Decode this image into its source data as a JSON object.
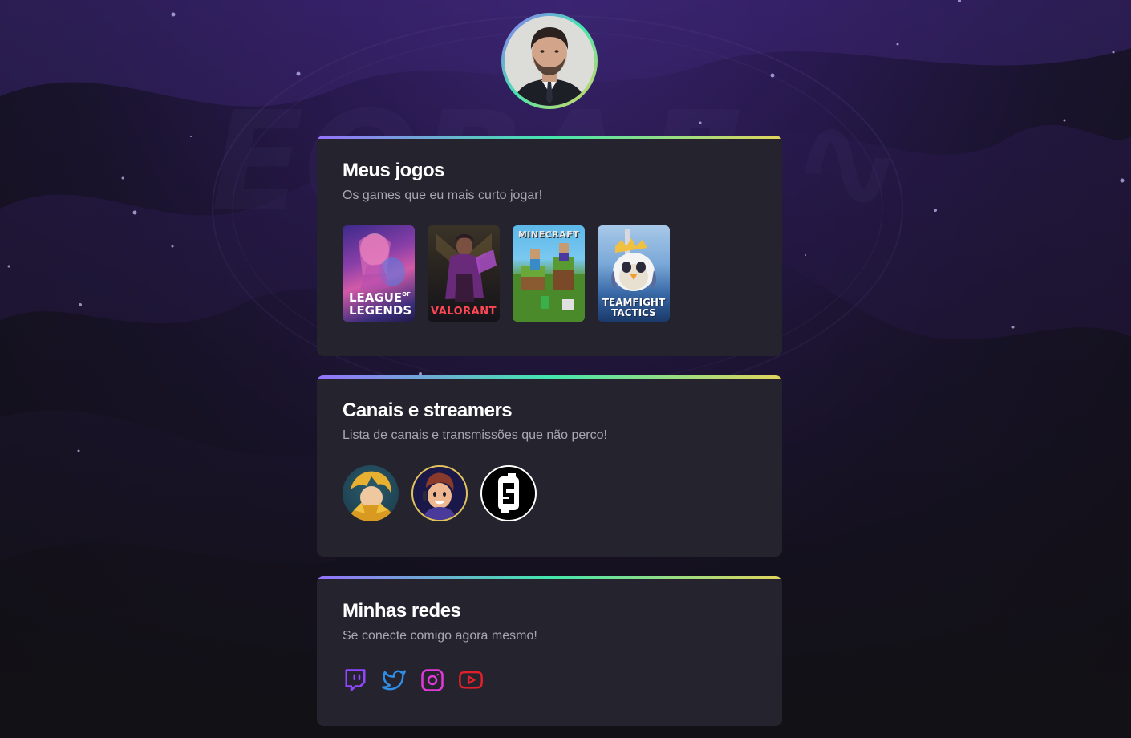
{
  "profile": {
    "avatar_alt": "profile-photo"
  },
  "games_card": {
    "title": "Meus jogos",
    "subtitle": "Os games que eu mais curto jogar!",
    "games": [
      {
        "name": "League of Legends",
        "label_line1": "LEAGUE",
        "label_line1_small": "OF",
        "label_line2": "LEGENDS"
      },
      {
        "name": "Valorant",
        "label": "VALORANT"
      },
      {
        "name": "Minecraft",
        "label": "MINECRAFT"
      },
      {
        "name": "Teamfight Tactics",
        "label_line1": "TEAMFIGHT",
        "label_line2": "TACTICS"
      }
    ]
  },
  "streamers_card": {
    "title": "Canais e streamers",
    "subtitle": "Lista de canais e transmissões que não perco!",
    "streamers": [
      {
        "name": "streamer-1"
      },
      {
        "name": "streamer-2"
      },
      {
        "name": "streamer-3"
      }
    ]
  },
  "socials_card": {
    "title": "Minhas redes",
    "subtitle": "Se conecte comigo agora mesmo!",
    "links": [
      {
        "name": "twitch",
        "icon": "twitch-icon",
        "color": "#9146ff"
      },
      {
        "name": "twitter",
        "icon": "twitter-icon",
        "color": "#2f8fe8"
      },
      {
        "name": "instagram",
        "icon": "instagram-icon",
        "color": "#e03ad8"
      },
      {
        "name": "youtube",
        "icon": "youtube-icon",
        "color": "#e0202a"
      }
    ]
  },
  "colors": {
    "card_bg": "#25232e",
    "accent_gradient": [
      "#9572fc",
      "#43e7ad",
      "#e2d45c"
    ],
    "text_primary": "#ffffff",
    "text_secondary": "#a9a7b3"
  }
}
